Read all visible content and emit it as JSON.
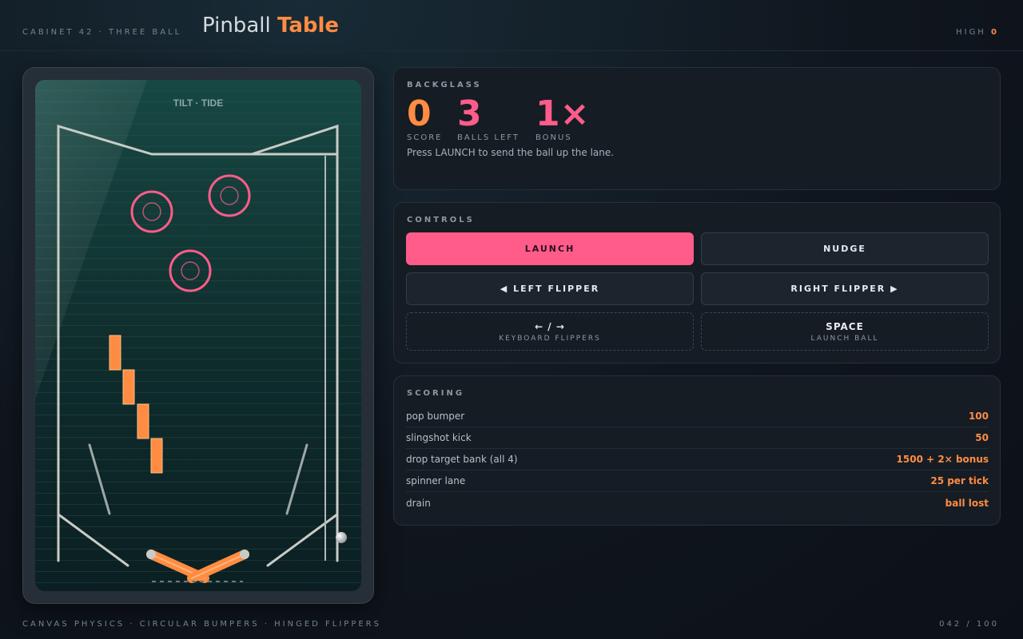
{
  "header": {
    "cabinet": "CABINET 42 · THREE BALL",
    "title_main": "Pinball",
    "title_accent": "Table",
    "high_label": "HIGH",
    "high_value": "0"
  },
  "table": {
    "label": "TILT · TIDE"
  },
  "backglass": {
    "label": "BACKGLASS",
    "score": "0",
    "score_label": "SCORE",
    "balls": "3",
    "balls_label": "BALLS LEFT",
    "bonus": "1×",
    "bonus_label": "BONUS",
    "message": "Press LAUNCH to send the ball up the lane."
  },
  "controls": {
    "label": "CONTROLS",
    "launch": "LAUNCH",
    "nudge": "NUDGE",
    "left_flipper": "◀ LEFT FLIPPER",
    "right_flipper": "RIGHT FLIPPER ▶",
    "hint1_key": "← / →",
    "hint1_desc": "KEYBOARD FLIPPERS",
    "hint2_key": "SPACE",
    "hint2_desc": "LAUNCH BALL"
  },
  "scoring": {
    "label": "SCORING",
    "rows": [
      {
        "name": "pop bumper",
        "points": "100"
      },
      {
        "name": "slingshot kick",
        "points": "50"
      },
      {
        "name": "drop target bank (all 4)",
        "points": "1500 + 2× bonus"
      },
      {
        "name": "spinner lane",
        "points": "25 per tick"
      },
      {
        "name": "drain",
        "points": "ball lost"
      }
    ]
  },
  "footer": {
    "left": "CANVAS PHYSICS · CIRCULAR BUMPERS · HINGED FLIPPERS",
    "right": "042 / 100"
  },
  "colors": {
    "accent_orange": "#ff8c42",
    "accent_pink": "#ff5c8a",
    "rail": "#c9cbc6"
  }
}
